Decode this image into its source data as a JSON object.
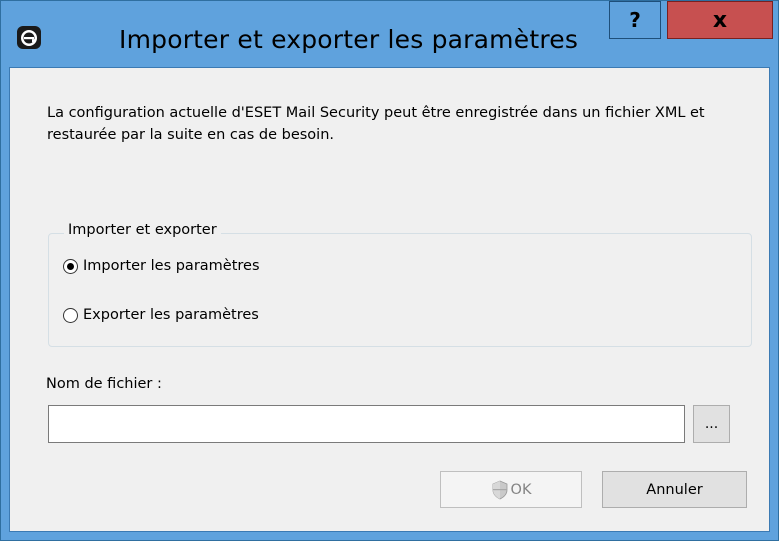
{
  "window": {
    "title": "Importer et exporter les paramètres",
    "help_label": "?",
    "close_label": "x"
  },
  "description": "La configuration actuelle d'ESET Mail Security peut être enregistrée dans un fichier XML et restaurée par la suite en cas de besoin.",
  "group": {
    "legend": "Importer et exporter",
    "options": [
      {
        "label": "Importer les paramètres",
        "selected": true
      },
      {
        "label": "Exporter les paramètres",
        "selected": false
      }
    ]
  },
  "file": {
    "label": "Nom de fichier :",
    "value": "",
    "browse_label": "..."
  },
  "buttons": {
    "ok_label": "OK",
    "ok_enabled": false,
    "cancel_label": "Annuler"
  },
  "colors": {
    "titlebar": "#5fa2dd",
    "close": "#c75050",
    "client_bg": "#f0f0f0"
  },
  "icons": {
    "app": "eset-logo-icon",
    "ok": "uac-shield-icon"
  }
}
